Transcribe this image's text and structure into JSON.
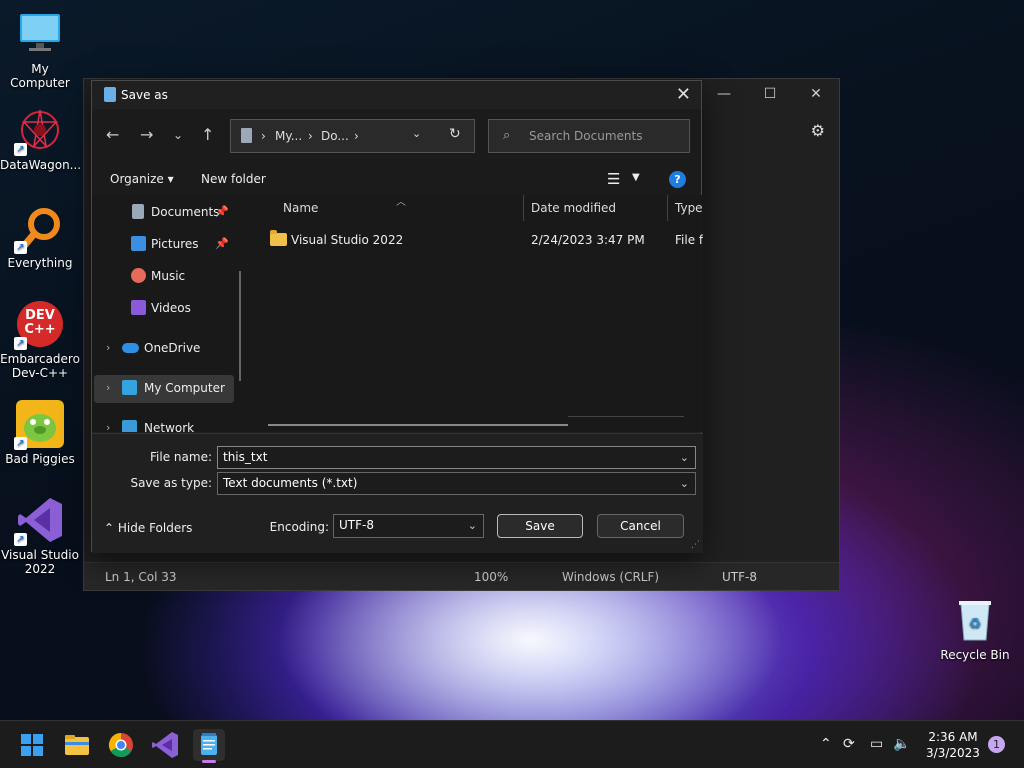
{
  "desktop": {
    "icons": [
      {
        "label": "My Computer",
        "icon": "monitor-icon"
      },
      {
        "label": "DataWagon...",
        "icon": "datawagon-icon"
      },
      {
        "label": "Everything",
        "icon": "everything-search-icon"
      },
      {
        "label": "Embarcadero Dev-C++",
        "icon": "devcpp-icon",
        "badge": "DEV C++"
      },
      {
        "label": "Bad Piggies",
        "icon": "bad-piggies-icon"
      },
      {
        "label": "Visual Studio 2022",
        "icon": "visual-studio-icon"
      }
    ],
    "recycle_bin": {
      "label": "Recycle Bin",
      "icon": "recycle-bin-icon"
    }
  },
  "notepad": {
    "statusbar": {
      "position": "Ln 1, Col 33",
      "zoom": "100%",
      "line_ending": "Windows (CRLF)",
      "encoding": "UTF-8"
    }
  },
  "dialog": {
    "title": "Save as",
    "address": {
      "seg1": "My...",
      "seg2": "Do..."
    },
    "search_placeholder": "Search Documents",
    "organize_label": "Organize",
    "new_folder_label": "New folder",
    "help_label": "?",
    "nav_items": [
      {
        "label": "Documents",
        "icon": "documents-icon",
        "pinned": true
      },
      {
        "label": "Pictures",
        "icon": "pictures-icon",
        "pinned": true
      },
      {
        "label": "Music",
        "icon": "music-icon"
      },
      {
        "label": "Videos",
        "icon": "videos-icon"
      },
      {
        "label": "OneDrive",
        "icon": "onedrive-icon"
      },
      {
        "label": "My Computer",
        "icon": "computer-icon"
      },
      {
        "label": "Network",
        "icon": "network-icon"
      }
    ],
    "columns": {
      "name": "Name",
      "date": "Date modified",
      "type": "Type"
    },
    "files": [
      {
        "name": "Visual Studio 2022",
        "date": "2/24/2023 3:47 PM",
        "type": "File folder"
      }
    ],
    "file_name_label": "File name:",
    "file_name_value": "this_txt",
    "save_type_label": "Save as type:",
    "save_type_value": "Text documents (*.txt)",
    "hide_folders_label": "Hide Folders",
    "encoding_label": "Encoding:",
    "encoding_value": "UTF-8",
    "save_label": "Save",
    "cancel_label": "Cancel"
  },
  "taskbar": {
    "apps": [
      "start-icon",
      "file-explorer-icon",
      "chrome-icon",
      "visual-studio-icon",
      "notepad-icon"
    ],
    "time": "2:36 AM",
    "date": "3/3/2023",
    "notification_count": "1"
  },
  "colors": {
    "dialog_bg": "#202020",
    "accent": "#1e7ee0",
    "folder": "#f0c04a"
  }
}
